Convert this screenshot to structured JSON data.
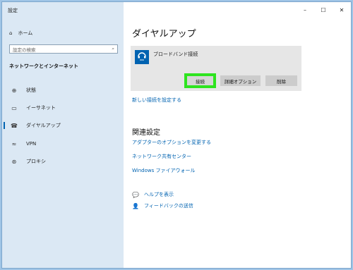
{
  "window": {
    "title": "設定",
    "controls": {
      "minimize": "–",
      "maximize": "☐",
      "close": "✕"
    }
  },
  "sidebar": {
    "home_label": "ホーム",
    "search_placeholder": "設定の検索",
    "section_title": "ネットワークとインターネット",
    "items": [
      {
        "label": "状態",
        "icon": "home-status-icon"
      },
      {
        "label": "イーサネット",
        "icon": "ethernet-icon"
      },
      {
        "label": "ダイヤルアップ",
        "icon": "dialup-icon",
        "selected": true
      },
      {
        "label": "VPN",
        "icon": "vpn-icon"
      },
      {
        "label": "プロキシ",
        "icon": "globe-icon"
      }
    ]
  },
  "main": {
    "title": "ダイヤルアップ",
    "connection": {
      "name": "ブロードバンド接続",
      "connect_label": "接続",
      "advanced_label": "詳細オプション",
      "delete_label": "削除"
    },
    "new_connection_link": "新しい接続を設定する",
    "related_title": "関連設定",
    "related_links": [
      "アダプターのオプションを変更する",
      "ネットワーク共有センター",
      "Windows ファイアウォール"
    ],
    "help_label": "ヘルプを表示",
    "feedback_label": "フィードバックの送信"
  },
  "colors": {
    "accent": "#0063b1",
    "highlight": "#2ee41f",
    "sidebar_bg": "#dbe8f4"
  }
}
